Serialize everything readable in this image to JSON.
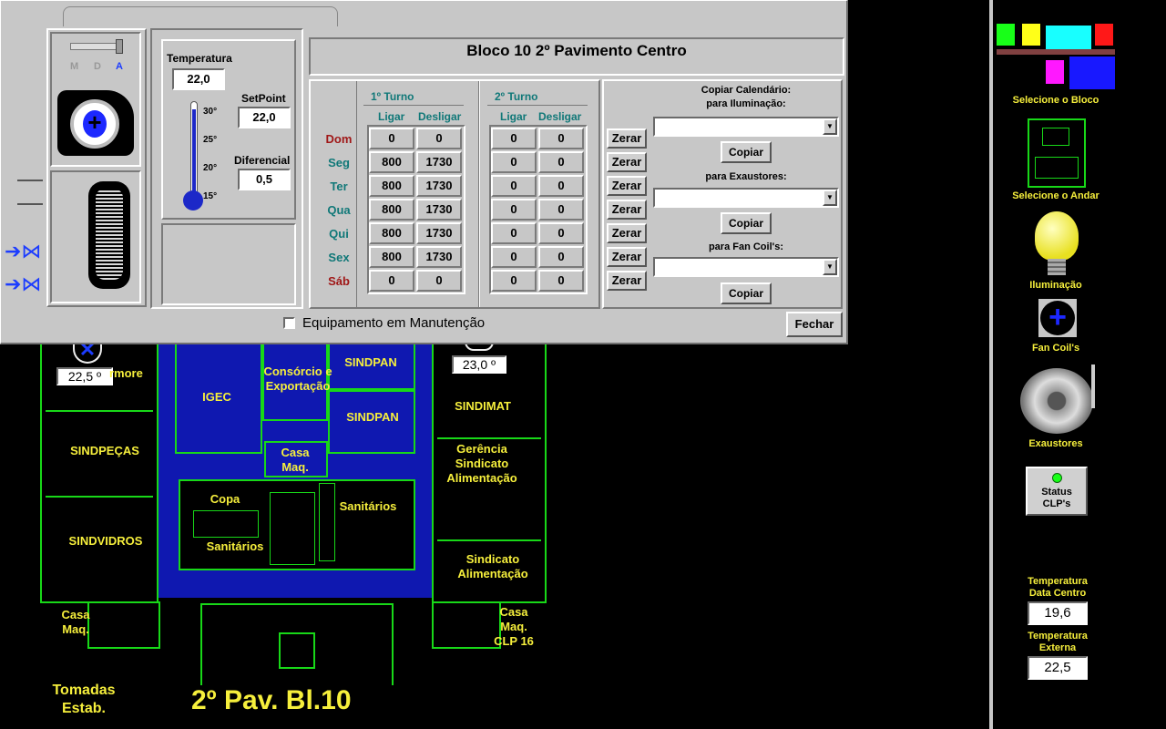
{
  "dialog": {
    "title": "Bloco 10 2º Pavimento Centro",
    "mode_labels": {
      "m": "M",
      "d": "D",
      "a": "A"
    },
    "temperature": {
      "label": "Temperatura",
      "value": "22,0",
      "ticks": [
        "30°",
        "25°",
        "20°",
        "15°"
      ]
    },
    "setpoint": {
      "label": "SetPoint",
      "value": "22,0"
    },
    "diferencial": {
      "label": "Diferencial",
      "value": "0,5"
    },
    "turno1": {
      "title": "1º Turno",
      "ligar": "Ligar",
      "desligar": "Desligar"
    },
    "turno2": {
      "title": "2º Turno",
      "ligar": "Ligar",
      "desligar": "Desligar"
    },
    "days": [
      {
        "name": "Dom",
        "t1_on": "0",
        "t1_off": "0",
        "t2_on": "0",
        "t2_off": "0"
      },
      {
        "name": "Seg",
        "t1_on": "800",
        "t1_off": "1730",
        "t2_on": "0",
        "t2_off": "0"
      },
      {
        "name": "Ter",
        "t1_on": "800",
        "t1_off": "1730",
        "t2_on": "0",
        "t2_off": "0"
      },
      {
        "name": "Qua",
        "t1_on": "800",
        "t1_off": "1730",
        "t2_on": "0",
        "t2_off": "0"
      },
      {
        "name": "Qui",
        "t1_on": "800",
        "t1_off": "1730",
        "t2_on": "0",
        "t2_off": "0"
      },
      {
        "name": "Sex",
        "t1_on": "800",
        "t1_off": "1730",
        "t2_on": "0",
        "t2_off": "0"
      },
      {
        "name": "Sáb",
        "t1_on": "0",
        "t1_off": "0",
        "t2_on": "0",
        "t2_off": "0"
      }
    ],
    "zerar_label": "Zerar",
    "copy": {
      "title_line1": "Copiar Calendário:",
      "iluminacao": "para Iluminação:",
      "exaustores": "para Exaustores:",
      "fancoils": "para Fan Coil's:",
      "button": "Copiar"
    },
    "maintenance": "Equipamento em Manutenção",
    "close": "Fechar"
  },
  "plan": {
    "title": "2º Pav. Bl.10",
    "tomadas": [
      "Tomadas",
      "Estab."
    ],
    "temp_left": "22,5 º",
    "temp_right": "23,0 º",
    "rooms": {
      "marmore": "rmore",
      "igec": "IGEC",
      "consorcio": [
        "Consórcio e",
        "Exportação"
      ],
      "sindpan1": "SINDPAN",
      "sindpan2": "SINDPAN",
      "sindimat": "SINDIMAT",
      "sindpecas": "SINDPEÇAS",
      "casa_maq_center": [
        "Casa",
        "Maq."
      ],
      "gerencia": [
        "Gerência",
        "Sindicato",
        "Alimentação"
      ],
      "copa": "Copa",
      "sanitarios1": "Sanitários",
      "sanitarios2": "Sanitários",
      "sindvidros": "SINDVIDROS",
      "sindicato": [
        "Sindicato",
        "Alimentação"
      ],
      "casa_maq_left": [
        "Casa",
        "Maq."
      ],
      "casa_maq_clp": [
        "Casa",
        "Maq.",
        "CLP 16"
      ]
    }
  },
  "sidebar": {
    "selecione_bloco": "Selecione o Bloco",
    "selecione_andar": "Selecione o Andar",
    "iluminacao": "Iluminação",
    "fancoils": "Fan Coil's",
    "exaustores": "Exaustores",
    "status": [
      "Status",
      "CLP's"
    ],
    "temp_dc_label": [
      "Temperatura",
      "Data Centro"
    ],
    "temp_dc_value": "19,6",
    "temp_ext_label": [
      "Temperatura",
      "Externa"
    ],
    "temp_ext_value": "22,5"
  },
  "colors": {
    "plan_lines": "#18d818",
    "plan_text": "#f6ef3c",
    "highlight": "#0f18b0",
    "weekend": "#a01818",
    "weekday": "#107878"
  }
}
